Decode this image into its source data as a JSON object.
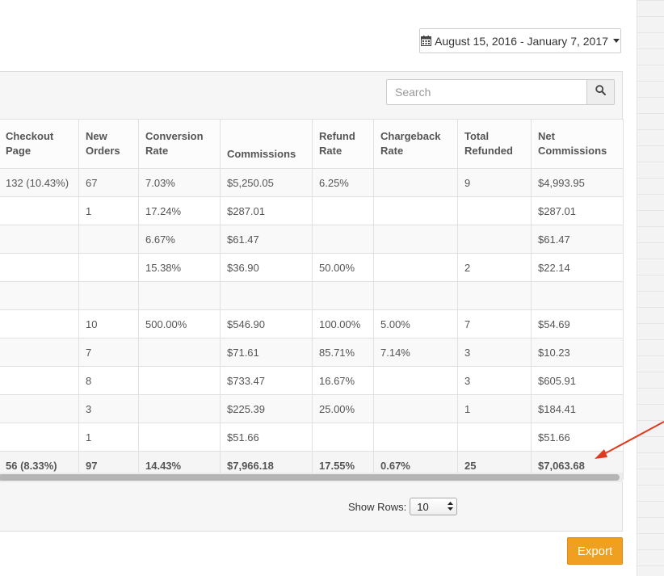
{
  "date_range": {
    "label": "August 15, 2016 - January 7, 2017"
  },
  "search": {
    "placeholder": "Search"
  },
  "table": {
    "headers": [
      "Checkout Page",
      "New Orders",
      "Conversion Rate",
      "Commissions",
      "Refund Rate",
      "Chargeback Rate",
      "Total Refunded",
      "Net Commissions"
    ],
    "rows": [
      [
        "132 (10.43%)",
        "67",
        "7.03%",
        "$5,250.05",
        "6.25%",
        "",
        "9",
        "$4,993.95"
      ],
      [
        "",
        "1",
        "17.24%",
        "$287.01",
        "",
        "",
        "",
        "$287.01"
      ],
      [
        "",
        "",
        "6.67%",
        "$61.47",
        "",
        "",
        "",
        "$61.47"
      ],
      [
        "",
        "",
        "15.38%",
        "$36.90",
        "50.00%",
        "",
        "2",
        "$22.14"
      ],
      [
        "",
        "",
        "",
        "",
        "",
        "",
        "",
        ""
      ],
      [
        "",
        "10",
        "500.00%",
        "$546.90",
        "100.00%",
        "5.00%",
        "7",
        "$54.69"
      ],
      [
        "",
        "7",
        "",
        "$71.61",
        "85.71%",
        "7.14%",
        "3",
        "$10.23"
      ],
      [
        "",
        "8",
        "",
        "$733.47",
        "16.67%",
        "",
        "3",
        "$605.91"
      ],
      [
        "",
        "3",
        "",
        "$225.39",
        "25.00%",
        "",
        "1",
        "$184.41"
      ],
      [
        "",
        "1",
        "",
        "$51.66",
        "",
        "",
        "",
        "$51.66"
      ]
    ],
    "totals": [
      "56 (8.33%)",
      "97",
      "14.43%",
      "$7,966.18",
      "17.55%",
      "0.67%",
      "25",
      "$7,063.68"
    ]
  },
  "pagination": {
    "show_rows_label": "Show Rows:",
    "show_rows_value": "10"
  },
  "export": {
    "label": "Export"
  },
  "colors": {
    "accent": "#f0a020",
    "arrow": "#e03a1e"
  },
  "icons": {
    "date": "calendar-icon",
    "search": "search-icon",
    "caret": "caret-down-icon",
    "select": "updown-arrows-icon"
  }
}
